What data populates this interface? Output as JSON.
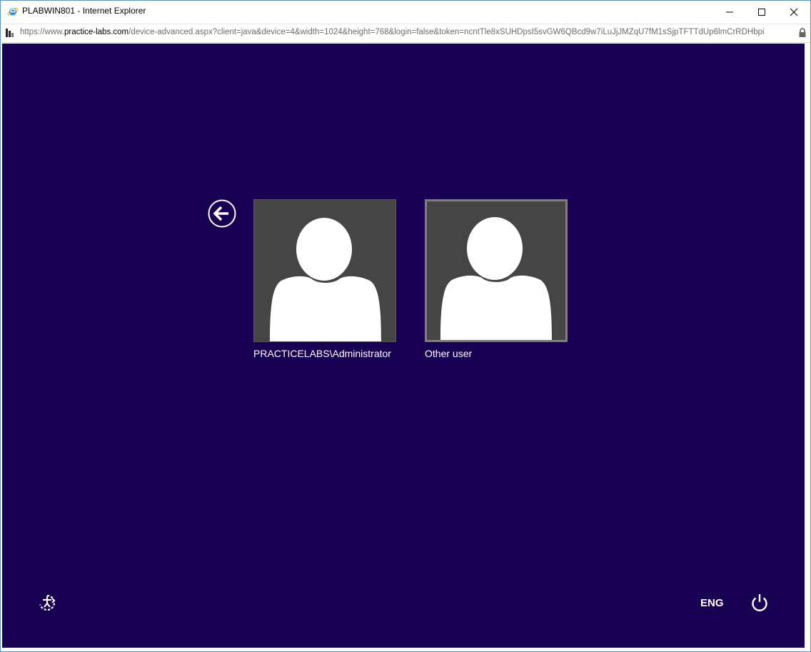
{
  "window": {
    "title": "PLABWIN801 - Internet Explorer",
    "minimize_icon": "minimize-icon",
    "maximize_icon": "maximize-icon",
    "close_icon": "close-icon"
  },
  "addressbar": {
    "url_prefix": "https://www.",
    "url_domain": "practice-labs.com",
    "url_path": "/device-advanced.aspx?client=java&device=4&width=1024&height=768&login=false&token=ncntTle8xSUHDpsI5svGW6QBcd9w7iLuJjJMZqU7fM1sSjpTFTTdUp6lmCrRDHbpi",
    "lock_icon": "lock-icon"
  },
  "lockscreen": {
    "background_color": "#180052",
    "back_icon": "back-arrow-icon",
    "users": [
      {
        "label": "PRACTICELABS\\Administrator",
        "avatar_icon": "user-avatar-icon"
      },
      {
        "label": "Other user",
        "avatar_icon": "user-avatar-icon"
      }
    ],
    "ease_of_access_icon": "ease-of-access-icon",
    "language": "ENG",
    "power_icon": "power-icon"
  }
}
